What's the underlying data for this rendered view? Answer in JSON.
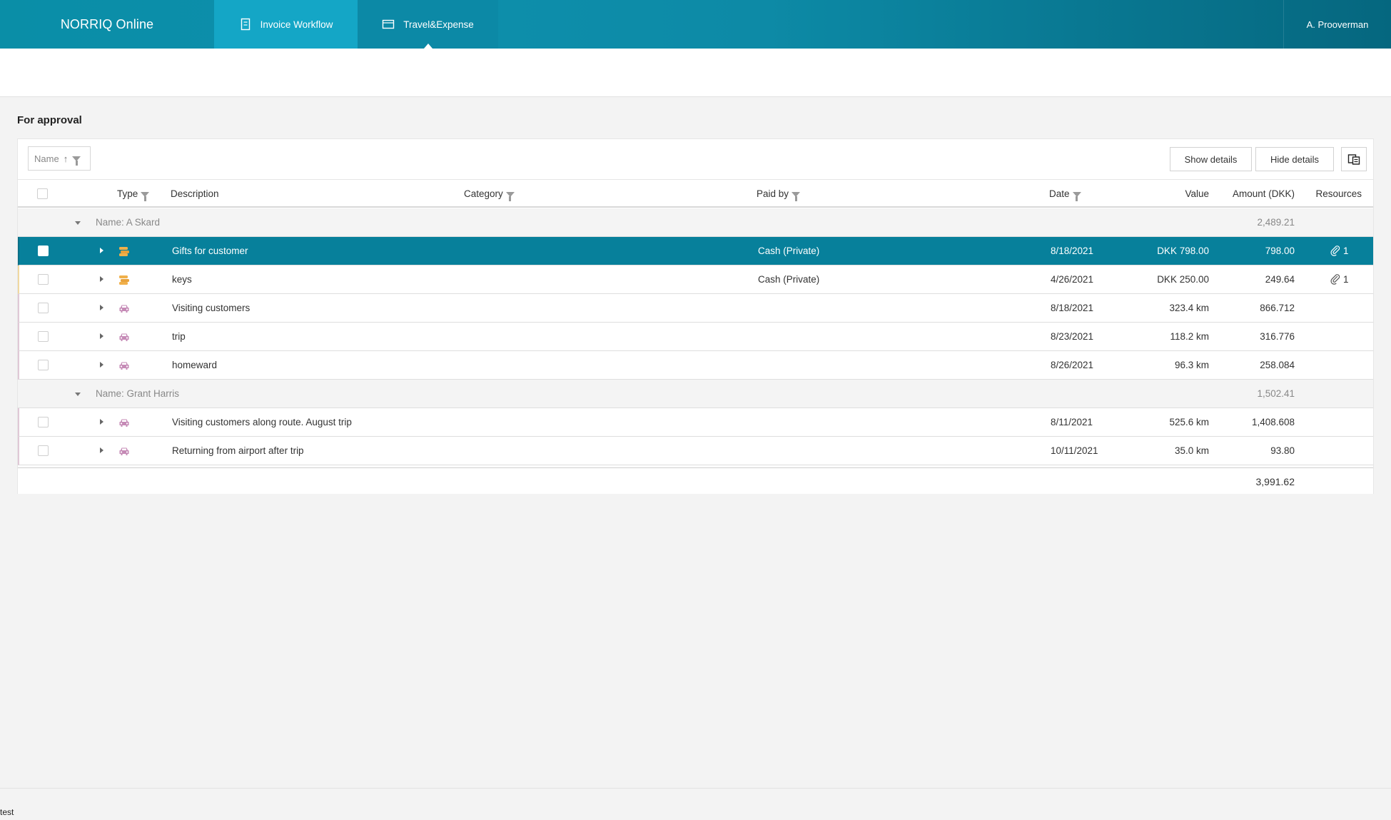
{
  "app": {
    "brand": "NORRIQ Online",
    "tabs": [
      {
        "label": "Invoice Workflow",
        "icon": "document-icon"
      },
      {
        "label": "Travel&Expense",
        "icon": "wallet-icon"
      }
    ],
    "user": "A. Prooverman"
  },
  "page": {
    "title": "For approval",
    "grouping_chip": "Name",
    "buttons": {
      "show_details": "Show details",
      "hide_details": "Hide details"
    },
    "footer_text": "test"
  },
  "table": {
    "headers": {
      "type": "Type",
      "description": "Description",
      "category": "Category",
      "paid_by": "Paid by",
      "date": "Date",
      "value": "Value",
      "amount": "Amount (DKK)",
      "resources": "Resources"
    },
    "groups": [
      {
        "label": "Name: A Skard",
        "total": "2,489.21",
        "rows": [
          {
            "type": "receipt",
            "description": "Gifts for customer",
            "category": "",
            "paid_by": "Cash (Private)",
            "date": "8/18/2021",
            "value": "DKK 798.00",
            "amount": "798.00",
            "resources": "1",
            "selected": true
          },
          {
            "type": "receipt",
            "description": "keys",
            "category": "",
            "paid_by": "Cash (Private)",
            "date": "4/26/2021",
            "value": "DKK 250.00",
            "amount": "249.64",
            "resources": "1"
          },
          {
            "type": "car",
            "description": "Visiting customers",
            "category": "",
            "paid_by": "",
            "date": "8/18/2021",
            "value": "323.4 km",
            "amount": "866.712",
            "resources": ""
          },
          {
            "type": "car",
            "description": "trip",
            "category": "",
            "paid_by": "",
            "date": "8/23/2021",
            "value": "118.2 km",
            "amount": "316.776",
            "resources": ""
          },
          {
            "type": "car",
            "description": "homeward",
            "category": "",
            "paid_by": "",
            "date": "8/26/2021",
            "value": "96.3 km",
            "amount": "258.084",
            "resources": ""
          }
        ]
      },
      {
        "label": "Name: Grant Harris",
        "total": "1,502.41",
        "rows": [
          {
            "type": "car",
            "description": "Visiting customers along route. August trip",
            "category": "",
            "paid_by": "",
            "date": "8/11/2021",
            "value": "525.6 km",
            "amount": "1,408.608",
            "resources": ""
          },
          {
            "type": "car",
            "description": "Returning from airport after trip",
            "category": "",
            "paid_by": "",
            "date": "10/11/2021",
            "value": "35.0 km",
            "amount": "93.80",
            "resources": ""
          }
        ]
      }
    ],
    "grand_total": "3,991.62"
  },
  "colors": {
    "header_gradient_start": "#0a8ea7",
    "header_gradient_end": "#05677f",
    "active_tab": "#14a6c6",
    "selected_row": "#07809b",
    "receipt_icon": "#e8a23c",
    "car_icon": "#c58ab6"
  }
}
